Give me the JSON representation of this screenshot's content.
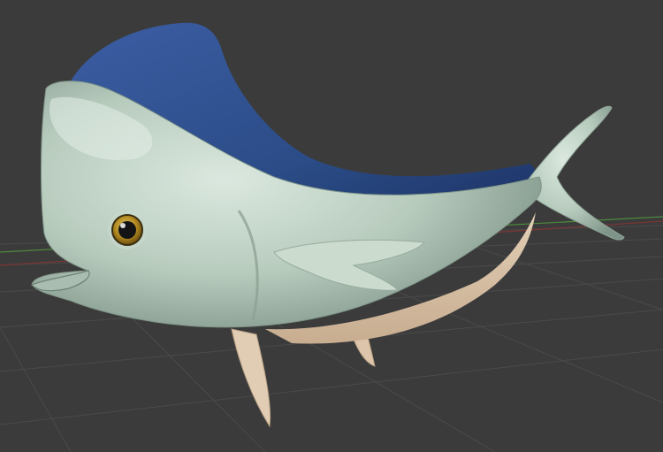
{
  "viewport": {
    "background": "#3b3b3b",
    "grid_color": "#4a4a4a",
    "axis_x_color": "#8a3a3a",
    "axis_y_color": "#4a8a3a"
  },
  "model": {
    "body_color": "#b9cdbd",
    "dorsal_fin_color": "#2f4a86",
    "belly_color": "#d9c2a7",
    "eye_color": "#b28a1f"
  }
}
